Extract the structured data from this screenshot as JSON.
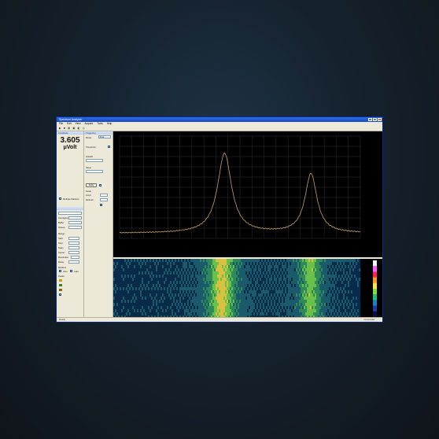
{
  "window": {
    "title": "Spectrum Analyzer",
    "menu": [
      "File",
      "Edit",
      "View",
      "Acquire",
      "Tools",
      "Help"
    ]
  },
  "readout": {
    "header": "Amplitude",
    "value": "3.605",
    "unit": "μVolt"
  },
  "panel_left": {
    "labels": [
      "Averaging",
      "Buffer",
      "Sweep",
      "Range",
      "Start",
      "Stop",
      "Span",
      "Center",
      "Resolution",
      "Delay",
      "Markers",
      "Peaks"
    ],
    "checkbox_labels": [
      "Multiple Markers",
      "Zero",
      "Auto"
    ]
  },
  "panel_right": {
    "labels": [
      "Triggering",
      "Mode",
      "Threshold",
      "Holdoff",
      "Slope",
      "Scale",
      "Ampl.",
      "Refresh"
    ],
    "button_label": "Apply",
    "mode_value": "Free"
  },
  "plot": {
    "background": "#000000",
    "grid_color": "#3a3a3a",
    "trace_color": "#c8a070",
    "peaks": [
      {
        "center": 0.436,
        "height": 0.78,
        "width": 0.035
      },
      {
        "center": 0.795,
        "height": 0.58,
        "width": 0.03
      }
    ],
    "baseline": 0.05
  },
  "spectrogram": {
    "colors": [
      "#0a2a4a",
      "#1a5a6a",
      "#2f8a5a",
      "#6ac04a",
      "#d8c040"
    ]
  },
  "status": {
    "left": "Ready",
    "right": "Connected"
  }
}
